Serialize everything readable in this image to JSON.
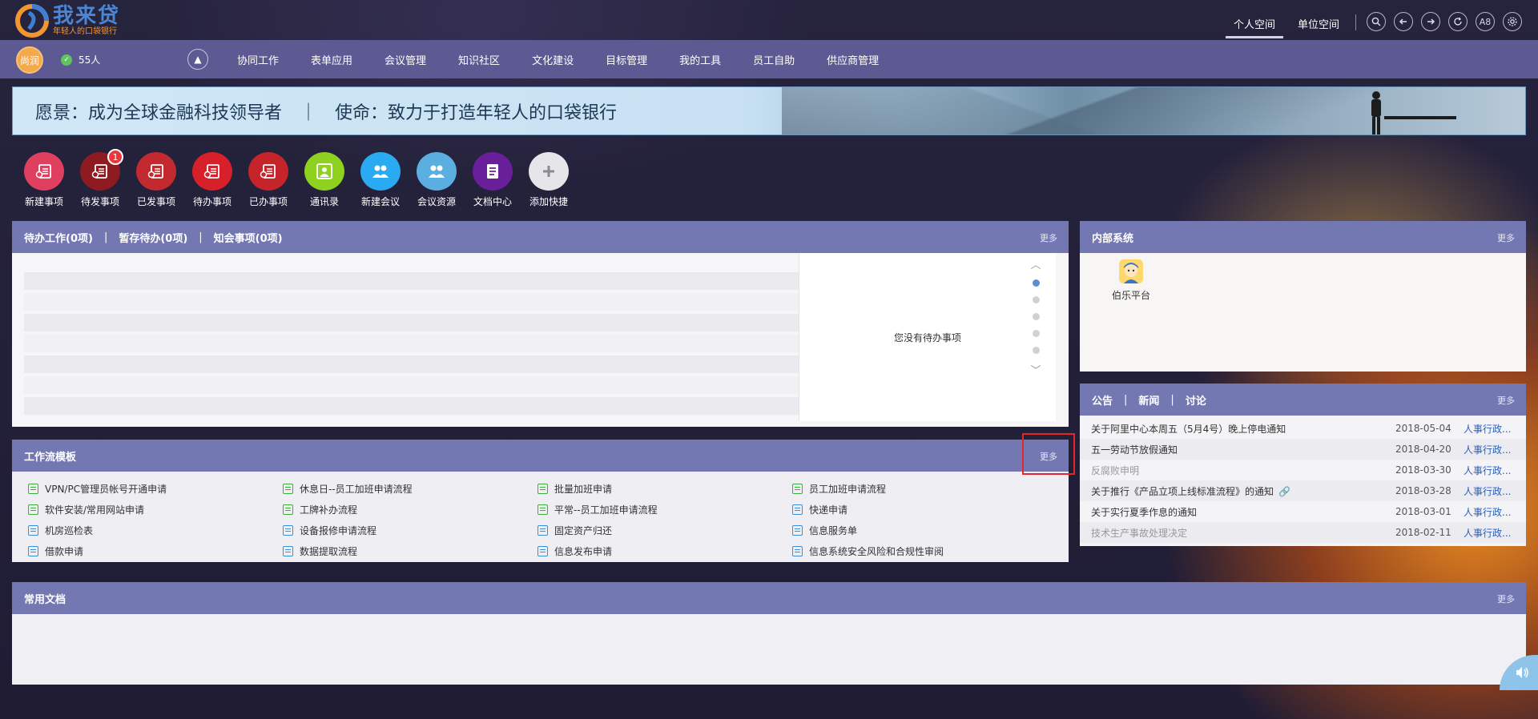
{
  "header": {
    "logo_title": "我来贷",
    "logo_subtitle": "年轻人的口袋银行",
    "space_tabs": [
      "个人空间",
      "单位空间"
    ],
    "top_icons": [
      "search-icon",
      "back-icon",
      "forward-icon",
      "refresh-icon",
      "a8-icon",
      "settings-icon"
    ],
    "a8_label": "A8"
  },
  "navbar": {
    "avatar_text": "尚润",
    "online_count": "55人",
    "menu": [
      "协同工作",
      "表单应用",
      "会议管理",
      "知识社区",
      "文化建设",
      "目标管理",
      "我的工具",
      "员工自助",
      "供应商管理"
    ]
  },
  "banner": {
    "text": "愿景：成为全球金融科技领导者　｜　使命：致力于打造年轻人的口袋银行"
  },
  "quick_links": [
    {
      "label": "新建事项",
      "color": "#e04060",
      "icon": "doc-icon"
    },
    {
      "label": "待发事项",
      "color": "#8e1b22",
      "icon": "doc-icon",
      "badge": "1"
    },
    {
      "label": "已发事项",
      "color": "#c22a2f",
      "icon": "doc-icon"
    },
    {
      "label": "待办事项",
      "color": "#d8202a",
      "icon": "doc-icon"
    },
    {
      "label": "已办事项",
      "color": "#c4242a",
      "icon": "doc-icon"
    },
    {
      "label": "通讯录",
      "color": "#8fd11f",
      "icon": "contact-icon"
    },
    {
      "label": "新建会议",
      "color": "#2aaaf0",
      "icon": "meeting-icon"
    },
    {
      "label": "会议资源",
      "color": "#5aaee0",
      "icon": "meeting-icon"
    },
    {
      "label": "文档中心",
      "color": "#6a1f9a",
      "icon": "folder-icon"
    },
    {
      "label": "添加快捷",
      "color": "#e6e6ea",
      "icon": "plus-icon"
    }
  ],
  "todo_panel": {
    "tabs": [
      "待办工作(0项)",
      "暂存待办(0项)",
      "知会事项(0项)"
    ],
    "more": "更多",
    "empty_text": "您没有待办事项"
  },
  "workflow_panel": {
    "title": "工作流模板",
    "more": "更多",
    "items": [
      {
        "label": "VPN/PC管理员帐号开通申请",
        "icon": "green"
      },
      {
        "label": "休息日--员工加班申请流程",
        "icon": "green"
      },
      {
        "label": "批量加班申请",
        "icon": "green"
      },
      {
        "label": "员工加班申请流程",
        "icon": "green"
      },
      {
        "label": "软件安装/常用网站申请",
        "icon": "green"
      },
      {
        "label": "工牌补办流程",
        "icon": "green"
      },
      {
        "label": "平常--员工加班申请流程",
        "icon": "green"
      },
      {
        "label": "快递申请",
        "icon": "blue"
      },
      {
        "label": "机房巡检表",
        "icon": "blue"
      },
      {
        "label": "设备报修申请流程",
        "icon": "blue"
      },
      {
        "label": "固定资产归还",
        "icon": "blue"
      },
      {
        "label": "信息服务单",
        "icon": "blue"
      },
      {
        "label": "借款申请",
        "icon": "blue"
      },
      {
        "label": "数据提取流程",
        "icon": "blue"
      },
      {
        "label": "信息发布申请",
        "icon": "blue"
      },
      {
        "label": "信息系统安全风险和合规性审阅",
        "icon": "blue"
      }
    ]
  },
  "internal_panel": {
    "title": "内部系统",
    "more": "更多",
    "systems": [
      {
        "label": "伯乐平台"
      }
    ]
  },
  "notice_panel": {
    "tabs": [
      "公告",
      "新闻",
      "讨论"
    ],
    "more": "更多",
    "rows": [
      {
        "title": "关于阿里中心本周五（5月4号）晚上停电通知",
        "date": "2018-05-04",
        "author": "人事行政...",
        "read": false
      },
      {
        "title": "五一劳动节放假通知",
        "date": "2018-04-20",
        "author": "人事行政...",
        "read": false
      },
      {
        "title": "反腐败申明",
        "date": "2018-03-30",
        "author": "人事行政...",
        "read": true
      },
      {
        "title": "关于推行《产品立项上线标准流程》的通知",
        "date": "2018-03-28",
        "author": "人事行政...",
        "read": false,
        "attachment": true
      },
      {
        "title": "关于实行夏季作息的通知",
        "date": "2018-03-01",
        "author": "人事行政...",
        "read": false
      },
      {
        "title": "技术生产事故处理决定",
        "date": "2018-02-11",
        "author": "人事行政...",
        "read": true
      }
    ]
  },
  "docs_panel": {
    "title": "常用文档",
    "more": "更多"
  }
}
